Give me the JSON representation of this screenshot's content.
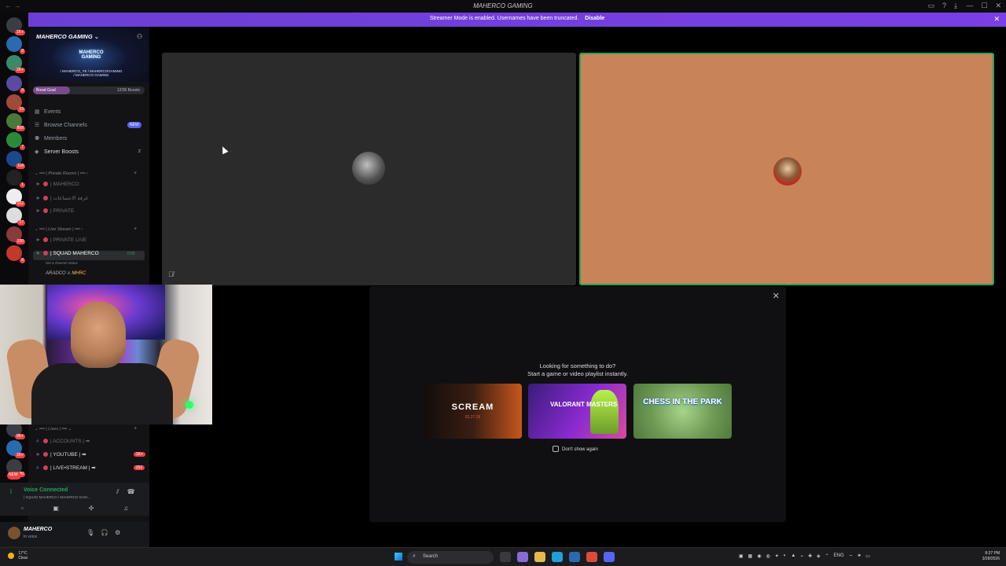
{
  "window": {
    "title": "MAHERCO GAMING"
  },
  "banner": {
    "message": "Streamer Mode is enabled. Usernames have been truncated.",
    "disable_label": "Disable"
  },
  "server_rail": {
    "badges": [
      "1K+",
      "8",
      "2K+",
      "9",
      "15",
      "858",
      "7",
      "118",
      "1",
      "102",
      "17",
      "130",
      "8",
      "9K+",
      "1K+",
      "30",
      "NEW"
    ]
  },
  "server": {
    "name": "MAHERCO GAMING",
    "logo_text": "MAHERCO GAMING",
    "socials_line1": "/ MAHERCO_YE   / MAHERCOGAMING",
    "socials_line2": "/ MAHERCO GAMING"
  },
  "boost": {
    "label": "Boost Goal",
    "count": "12/36 Boosts",
    "fill_fraction": 0.33
  },
  "nav": {
    "events": "Events",
    "browse_channels": "Browse Channels",
    "browse_tag": "NEW",
    "members": "Members",
    "server_boosts": "Server Boosts",
    "server_boosts_count": "2"
  },
  "categories": {
    "private_rooms": "| Private Rooms |",
    "live_stream": "| Live Stream |",
    "lives": "| Lives |"
  },
  "channels": {
    "private_1": "| MAHERCO",
    "private_2": "| غرفة الاجتماعات",
    "private_3": "| PRIVATE",
    "live_1": "| PRIVATE LIVE",
    "live_2": "| SQUAD MAHERCO",
    "live_2_time": "0:05",
    "live_2_status": "Set a channel status",
    "member_1": "ARADCO",
    "member_1_tag": "MHRC",
    "text_1": "| ACCOUNTS |",
    "text_2": "| YOUTUBE |",
    "text_2_badge": "1K+",
    "text_3": "| LIVE•STREAM |",
    "text_3_badge": "291"
  },
  "voice": {
    "status": "Voice Connected",
    "location": "| SQUAD MAHERCO / MAHERCO GAM..."
  },
  "user": {
    "name": "MAHERCO",
    "status": "In voice"
  },
  "activity": {
    "line1": "Looking for something to do?",
    "line2": "Start a game or video playlist instantly.",
    "card1_title": "SCREAM",
    "card1_sub": "02.27.26",
    "card2_title": "VALORANT MASTERS",
    "card3_title": "CHESS IN THE PARK",
    "dont_show": "Don't show again"
  },
  "taskbar": {
    "temp": "17°C",
    "weather": "Clear",
    "search": "Search",
    "lang": "ENG",
    "time": "8:37 PM",
    "date": "3/28/2026"
  }
}
